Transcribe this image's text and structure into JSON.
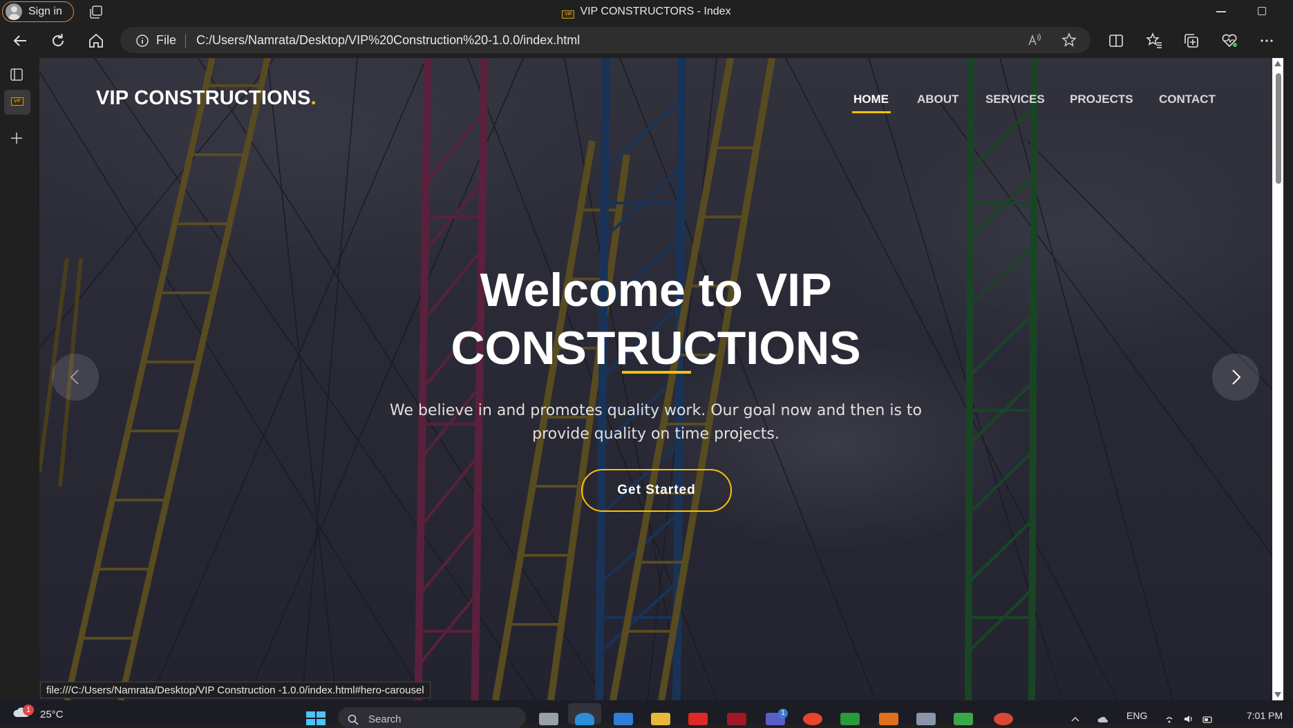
{
  "browser": {
    "signin_label": "Sign in",
    "window_title": "VIP CONSTRUCTORS - Index",
    "address_scheme": "File",
    "address_url": "C:/Users/Namrata/Desktop/VIP%20Construction%20-1.0.0/index.html",
    "favicon_text": "VIP",
    "status_url": "file:///C:/Users/Namrata/Desktop/VIP Construction -1.0.0/index.html#hero-carousel",
    "icons": [
      "tab-actions-icon",
      "back-icon",
      "refresh-icon",
      "home-icon",
      "info-icon",
      "read-aloud-icon",
      "favorite-star-icon",
      "split-screen-icon",
      "favorites-icon",
      "collections-icon",
      "browser-essentials-icon",
      "more-icon",
      "vertical-tabs-icon",
      "new-tab-icon"
    ]
  },
  "site": {
    "brand": "VIP CONSTRUCTIONS",
    "brand_dot": ".",
    "nav": [
      "HOME",
      "ABOUT",
      "SERVICES",
      "PROJECTS",
      "CONTACT"
    ],
    "active_nav": "HOME",
    "hero_title_line1": "Welcome to VIP",
    "hero_title_line2": "CONSTRUCTIONS",
    "hero_sub_line1": "We believe in and promotes quality work. Our goal now and then is to",
    "hero_sub_line2": "provide quality on time projects.",
    "cta_label": "Get Started",
    "colors": {
      "accent": "#ffc107",
      "overlay": "#14141e"
    }
  },
  "taskbar": {
    "weather_badge": "1",
    "temperature": "25°C",
    "search_placeholder": "Search",
    "teams_badge": "1",
    "language": "ENG",
    "time": "7:01 PM"
  }
}
